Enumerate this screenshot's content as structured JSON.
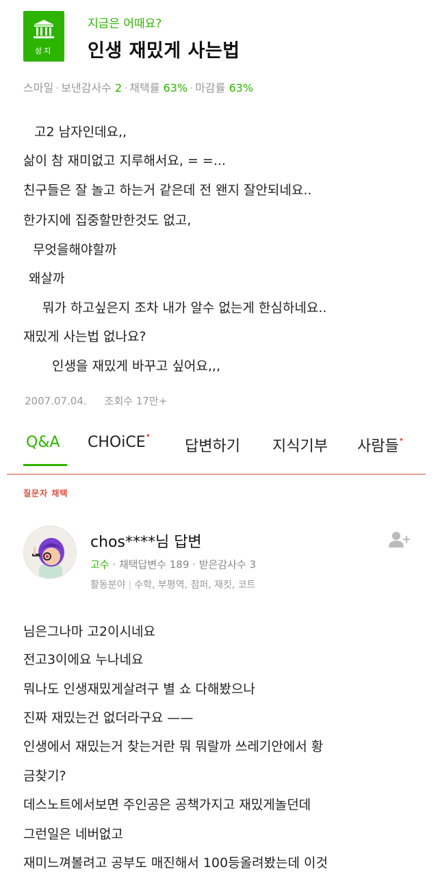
{
  "question": {
    "badge_label": "성지",
    "subtitle": "지금은 어때요?",
    "title": "인생 재밌게 사는법",
    "meta": {
      "author": "스마일",
      "thanks_label": "보낸감사수",
      "thanks_value": "2",
      "adopt_label": "채택률",
      "adopt_value": "63%",
      "close_label": "마감률",
      "close_value": "63%"
    },
    "body": [
      "고2 남자인데요,,",
      "삶이 참 재미없고 지루해서요, = =...",
      "친구들은 잘 놀고 하는거 같은데 전 왠지 잘안되네요..",
      "한가지에 집중할만한것도 없고,",
      "무엇을해야할까",
      "왜살까",
      "뭐가 하고싶은지 조차 내가 알수 없는게 한심하네요..",
      "재밌게 사는법 없나요?",
      "인생을 재밌게 바꾸고 싶어요,,,"
    ],
    "date": "2007.07.04.",
    "views": "조회수 17만+"
  },
  "tabs": {
    "qa": "Q&A",
    "choice": "CHOiCE",
    "answer": "답변하기",
    "donate": "지식기부",
    "people": "사람들",
    "new_mark": "•"
  },
  "chosen_label": "질문자 채택",
  "answer": {
    "name": "chos****님 답변",
    "level": "고수",
    "adopted_label": "채택답변수",
    "adopted_value": "189",
    "received_label": "받은감사수",
    "received_value": "3",
    "fields_label": "활동분야",
    "fields": "수학, 부평역, 점퍼, 재킷, 코트",
    "body": [
      "님은그나마 고2이시네요",
      "전고3이에요 누나네요",
      "뭐나도 인생재밌게살려구 별 쇼 다해봤으나",
      "진짜 재밌는건 없더라구요 ——",
      "인생에서 재밌는거 찾는거란 뭐 뭐랄까 쓰레기안에서 황",
      "금찾기?",
      "데스노트에서보면 주인공은 공책가지고 재밌게놀던데",
      "그런일은 네버없고",
      "재미느껴볼려고 공부도 매진해서 100등올려봤는데 이것"
    ]
  },
  "colors": {
    "brand_green": "#2db400",
    "accent_red": "#e04a3a"
  },
  "icons": {
    "badge": "building-icon",
    "follow": "add-user-icon"
  }
}
